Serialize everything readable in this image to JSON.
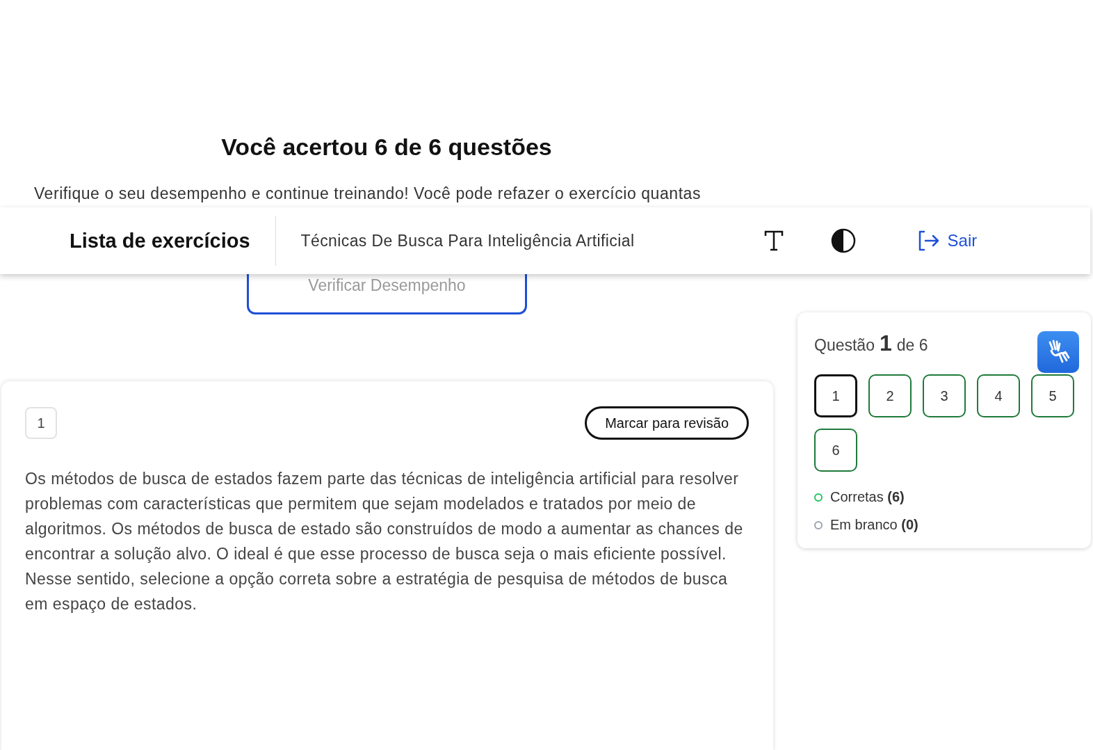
{
  "result": {
    "title": "Você acertou 6 de 6 questões",
    "message": "Verifique o seu desempenho e continue treinando! Você pode refazer o exercício quantas",
    "button": "Verificar Desempenho"
  },
  "header": {
    "title": "Lista de exercícios",
    "subject": "Técnicas De Busca Para Inteligência Artificial",
    "logout": "Sair"
  },
  "question": {
    "number": "1",
    "review_button": "Marcar para revisão",
    "text": "Os métodos de busca de estados fazem parte das técnicas de inteligência artificial para resolver problemas com características que permitem que sejam modelados e tratados por meio de algoritmos. Os métodos de busca de estado são construídos de modo a aumentar as chances de encontrar a solução alvo. O ideal é que esse processo de busca seja o mais eficiente possível. Nesse sentido, selecione a opção correta sobre a estratégia de pesquisa de métodos de busca em espaço de estados."
  },
  "navigator": {
    "prefix": "Questão",
    "current": "1",
    "suffix": "de 6",
    "questions": [
      {
        "label": "1",
        "selected": true,
        "correct": true
      },
      {
        "label": "2",
        "selected": false,
        "correct": true
      },
      {
        "label": "3",
        "selected": false,
        "correct": true
      },
      {
        "label": "4",
        "selected": false,
        "correct": true
      },
      {
        "label": "5",
        "selected": false,
        "correct": true
      },
      {
        "label": "6",
        "selected": false,
        "correct": true
      }
    ],
    "legend": [
      {
        "label": "Corretas",
        "count": "(6)",
        "color": "#22c55e"
      },
      {
        "label": "Em branco",
        "count": "(0)",
        "color": "#9ca3af"
      }
    ]
  }
}
